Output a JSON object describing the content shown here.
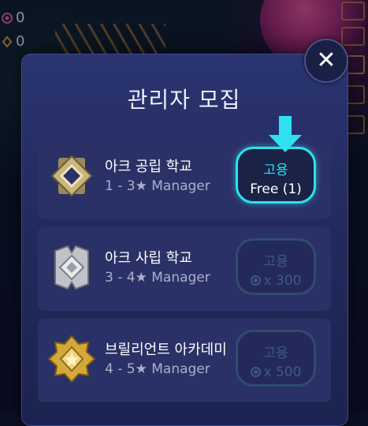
{
  "hud": {
    "gem_count": "0",
    "token_count": "0"
  },
  "dialog": {
    "title": "관리자 모집",
    "hire_label": "고용"
  },
  "schools": [
    {
      "name": "아크 공립 학교",
      "range": "1 - 3",
      "role": "Manager",
      "price": "Free (1)",
      "state": "available",
      "emblem": "bronze-diamond-emblem"
    },
    {
      "name": "아크 사립 학교",
      "range": "3 - 4",
      "role": "Manager",
      "price": "x 300",
      "state": "locked",
      "emblem": "silver-emblem"
    },
    {
      "name": "브릴리언트 아카데미",
      "range": "4 - 5",
      "role": "Manager",
      "price": "x 500",
      "state": "locked",
      "emblem": "gold-star-emblem"
    }
  ],
  "colors": {
    "accent": "#2fe0f0",
    "panel": "#222a5c",
    "card": "#2a3166",
    "locked": "#3e5b7e"
  }
}
